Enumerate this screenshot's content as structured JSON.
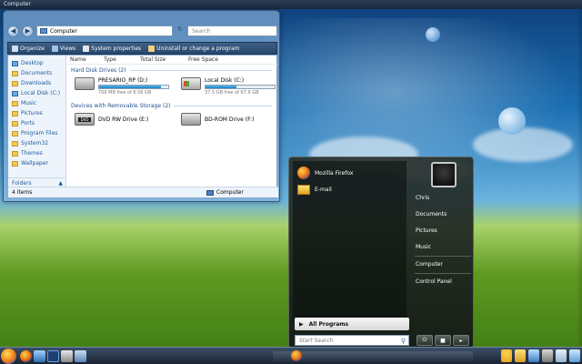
{
  "top_strip": {
    "title": "Computer"
  },
  "explorer": {
    "address": "Computer",
    "search_placeholder": "Search",
    "toolbar": [
      {
        "label": "Organize",
        "icon": "organize-icon"
      },
      {
        "label": "Views",
        "icon": "views-icon"
      },
      {
        "label": "System properties",
        "icon": "system-properties-icon"
      },
      {
        "label": "Uninstall or change a program",
        "icon": "uninstall-icon"
      }
    ],
    "nav_items": [
      {
        "label": "Desktop",
        "icon": "desktop-icon"
      },
      {
        "label": "Documents",
        "icon": "folder-icon"
      },
      {
        "label": "Downloads",
        "icon": "folder-icon"
      },
      {
        "label": "Local Disk (C:)",
        "icon": "drive-icon"
      },
      {
        "label": "Music",
        "icon": "music-icon"
      },
      {
        "label": "Pictures",
        "icon": "pictures-icon"
      },
      {
        "label": "Ports",
        "icon": "folder-icon"
      },
      {
        "label": "Program Files",
        "icon": "folder-icon"
      },
      {
        "label": "System32",
        "icon": "folder-icon"
      },
      {
        "label": "Themes",
        "icon": "folder-icon"
      },
      {
        "label": "Wallpaper",
        "icon": "folder-icon"
      }
    ],
    "folders_label": "Folders",
    "columns": [
      "Name",
      "Type",
      "Total Size",
      "Free Space"
    ],
    "group_hdd": "Hard Disk Drives (2)",
    "group_removable": "Devices with Removable Storage (2)",
    "drives": [
      {
        "name": "PRESARIO_RP (D:)",
        "detail": "706 MB free of 6.56 GB",
        "used_fraction": 0.9
      },
      {
        "name": "Local Disk (C:)",
        "detail": "37.5 GB free of 67.9 GB",
        "used_fraction": 0.45
      }
    ],
    "removable": [
      {
        "name": "DVD RW Drive (E:)"
      },
      {
        "name": "BD-ROM Drive (F:)"
      }
    ],
    "status_count": "4 items",
    "status_location": "Computer"
  },
  "start_menu": {
    "pinned": [
      {
        "label": "Mozilla Firefox",
        "icon": "firefox-icon"
      },
      {
        "label": "E-mail",
        "icon": "mail-icon"
      }
    ],
    "all_programs": "All Programs",
    "search_placeholder": "Start Search",
    "right_items": [
      "Chris",
      "Documents",
      "Pictures",
      "Music",
      "Computer",
      "Control Panel"
    ]
  }
}
